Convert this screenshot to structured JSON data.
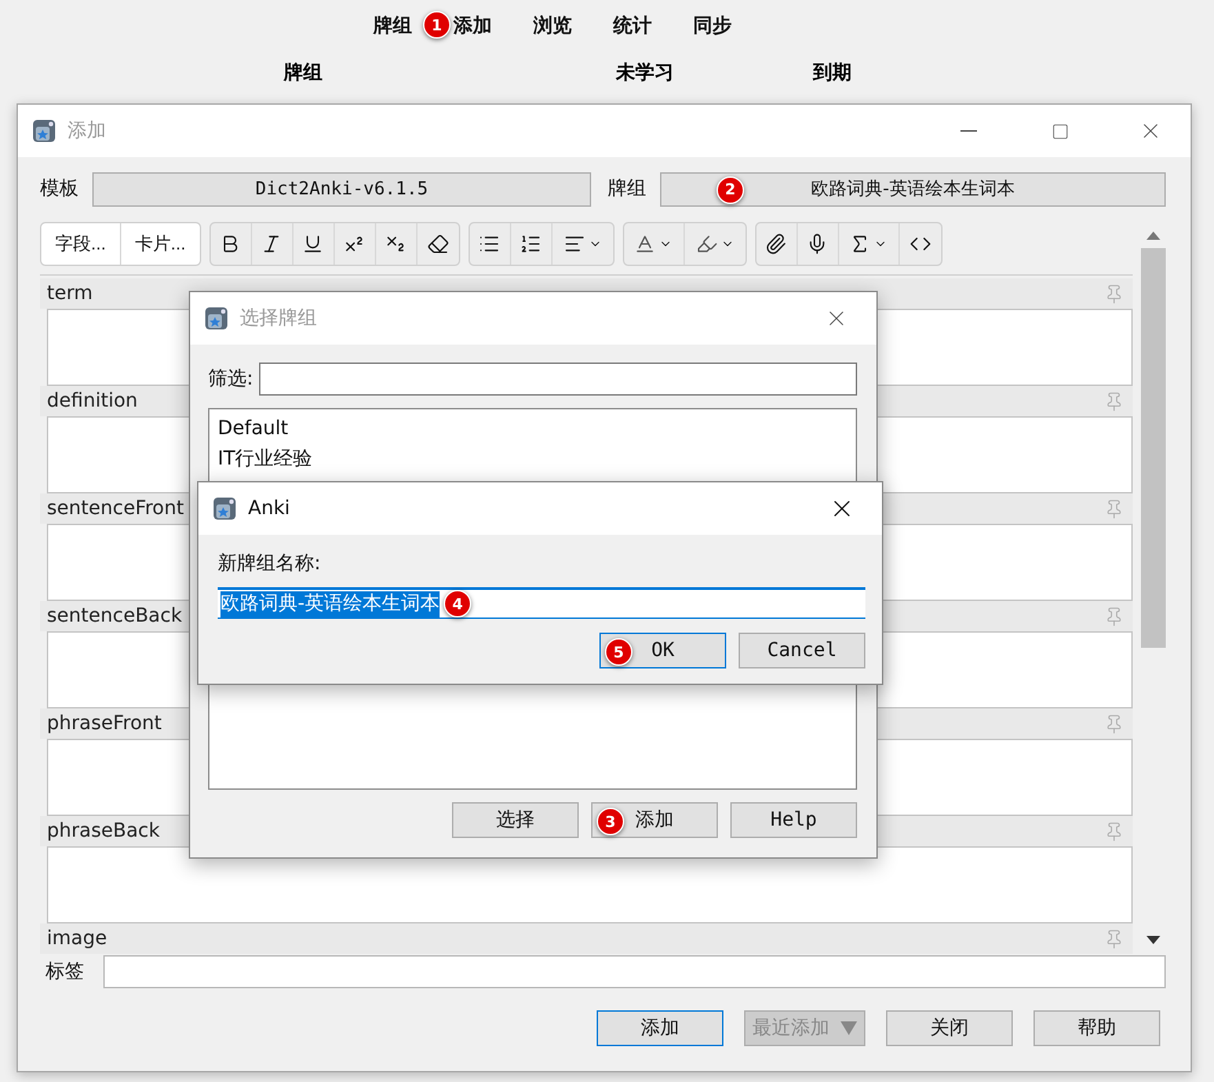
{
  "main_tabs": [
    {
      "label": "牌组"
    },
    {
      "label": "添加",
      "marker": "1"
    },
    {
      "label": "浏览"
    },
    {
      "label": "统计"
    },
    {
      "label": "同步"
    }
  ],
  "deck_columns": [
    "牌组",
    "未学习",
    "到期"
  ],
  "add_window": {
    "title": "添加",
    "note_type_label": "模板",
    "note_type": "Dict2Anki-v6.1.5",
    "deck_label": "牌组",
    "deck": "欧路词典-英语绘本生词本",
    "deck_marker": "2",
    "tool_buttons": [
      "字段...",
      "卡片..."
    ],
    "fields": [
      {
        "name": "term"
      },
      {
        "name": "definition"
      },
      {
        "name": "sentenceFront"
      },
      {
        "name": "sentenceBack"
      },
      {
        "name": "phraseFront"
      },
      {
        "name": "phraseBack"
      },
      {
        "name": "image"
      }
    ],
    "tags_label": "标签",
    "buttons": [
      {
        "label": "添加",
        "kind": "default",
        "disabled": false
      },
      {
        "label": "最近添加",
        "kind": "dropdown",
        "disabled": true
      },
      {
        "label": "关闭",
        "kind": "normal",
        "disabled": false
      },
      {
        "label": "帮助",
        "kind": "normal",
        "disabled": false
      }
    ]
  },
  "select_deck_dialog": {
    "title": "选择牌组",
    "filter_label": "筛选:",
    "decks": [
      "Default",
      "IT行业经验"
    ],
    "buttons": [
      {
        "label": "选择"
      },
      {
        "label": "添加",
        "marker": "3"
      },
      {
        "label": "Help"
      }
    ]
  },
  "name_dialog": {
    "title": "Anki",
    "label": "新牌组名称:",
    "value": "欧路词典-英语绘本生词本",
    "value_selected": true,
    "value_marker": "4",
    "buttons": [
      {
        "label": "OK",
        "kind": "default",
        "marker": "5"
      },
      {
        "label": "Cancel",
        "kind": "normal"
      }
    ]
  }
}
